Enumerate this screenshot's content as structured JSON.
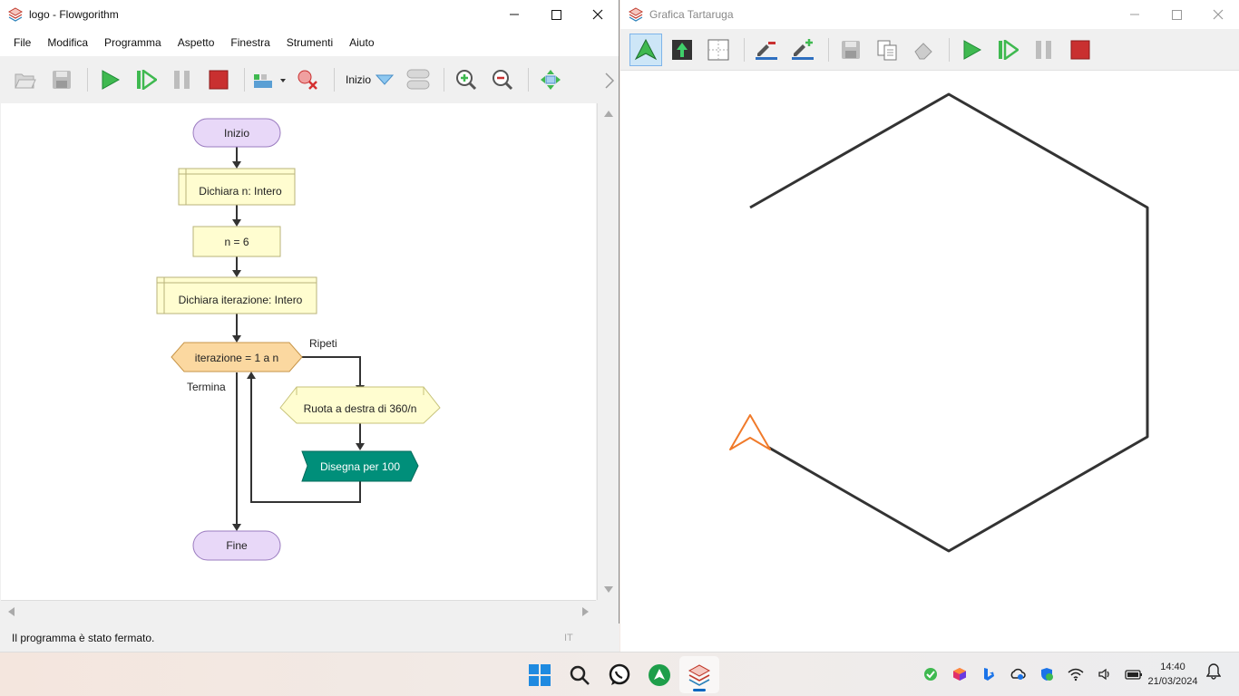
{
  "flowgorithm": {
    "title": "logo - Flowgorithm",
    "menu": [
      "File",
      "Modifica",
      "Programma",
      "Aspetto",
      "Finestra",
      "Strumenti",
      "Aiuto"
    ],
    "toolbar": {
      "zoom_mode_label": "Inizio"
    },
    "flowchart": {
      "start": "Inizio",
      "declare_n": "Dichiara n: Intero",
      "assign_n": "n = 6",
      "declare_iter": "Dichiara iterazione: Intero",
      "for_loop": "iterazione = 1 a n",
      "loop_label": "Ripeti",
      "exit_label": "Termina",
      "turn_right": "Ruota a destra di 360/n",
      "draw_forward": "Disegna per 100",
      "end": "Fine"
    },
    "status": {
      "message": "Il programma è stato fermato.",
      "language": "IT"
    }
  },
  "turtle": {
    "title": "Grafica Tartaruga",
    "line_color": "#333333",
    "turtle_color": "#f07a2a"
  },
  "taskbar": {
    "apps": [
      "windows-start",
      "search",
      "whatsapp",
      "app-green",
      "flowgorithm"
    ],
    "clock": {
      "time": "14:40",
      "date": "21/03/2024"
    }
  },
  "colors": {
    "terminal": "#e8d8f8",
    "process": "#fffdd0",
    "loop": "#fbd8a0",
    "output": "#008f7a"
  }
}
